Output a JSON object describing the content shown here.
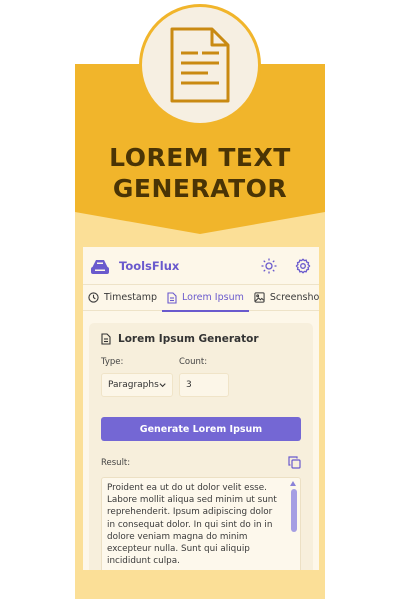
{
  "banner": {
    "title_line1": "LOREM TEXT",
    "title_line2": "GENERATOR",
    "badge_icon": "document-lines-icon",
    "colors": {
      "gold": "#f1b52b",
      "cream": "#fbdf97",
      "title": "#4a3405"
    }
  },
  "app": {
    "name": "ToolsFlux",
    "accent": "#6a5acd",
    "header_icons": [
      "sun-icon",
      "settings-gear-icon"
    ]
  },
  "tabs": [
    {
      "label": "Timestamp",
      "icon": "clock-icon",
      "active": false
    },
    {
      "label": "Lorem Ipsum",
      "icon": "document-icon",
      "active": true
    },
    {
      "label": "Screenshot",
      "icon": "image-icon",
      "active": false
    }
  ],
  "generator": {
    "heading": "Lorem Ipsum Generator",
    "type_label": "Type:",
    "type_value": "Paragraphs",
    "count_label": "Count:",
    "count_value": "3",
    "button_label": "Generate Lorem Ipsum",
    "result_label": "Result:",
    "result_text": "Proident ea ut do ut dolor velit esse. Labore mollit aliqua sed minim ut sunt reprehenderit. Ipsum adipiscing dolor in consequat dolor. In qui sint do in in dolore veniam magna do minim excepteur nulla. Sunt qui aliquip incididunt culpa."
  }
}
